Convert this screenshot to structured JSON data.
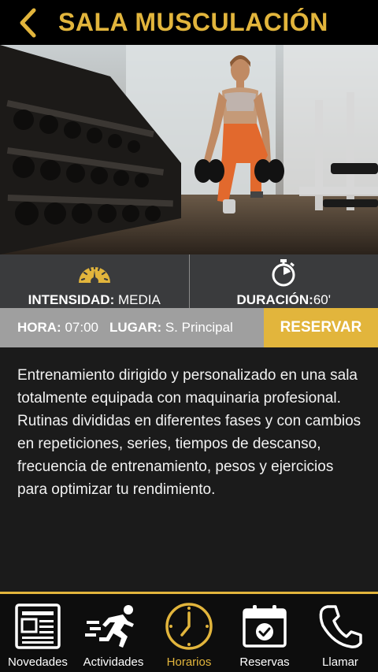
{
  "header": {
    "title": "SALA MUSCULACIÓN"
  },
  "stats": {
    "intensity_label": "INTENSIDAD:",
    "intensity_value": "MEDIA",
    "duration_label": "DURACIÓN:",
    "duration_value": "60'"
  },
  "schedule": {
    "hour_label": "HORA:",
    "hour_value": "07:00",
    "place_label": "LUGAR:",
    "place_value": "S. Principal",
    "reserve_label": "RESERVAR"
  },
  "description": "Entrenamiento dirigido y personalizado en una sala totalmente equipada con maquinaria profesional. Rutinas divididas en diferentes fases y con cambios en repeticiones, series, tiempos de descanso, frecuencia de entrenamiento, pesos y ejercicios para optimizar tu rendimiento.",
  "nav": {
    "items": [
      {
        "label": "Novedades"
      },
      {
        "label": "Actividades"
      },
      {
        "label": "Horarios"
      },
      {
        "label": "Reservas"
      },
      {
        "label": "Llamar"
      }
    ],
    "active": "Horarios"
  },
  "colors": {
    "accent": "#e2b53c",
    "header_bg": "#000000",
    "stats_bg": "#3a3b3d",
    "bar_bg": "#9f9f9f",
    "body_bg": "#1b1b1b"
  }
}
